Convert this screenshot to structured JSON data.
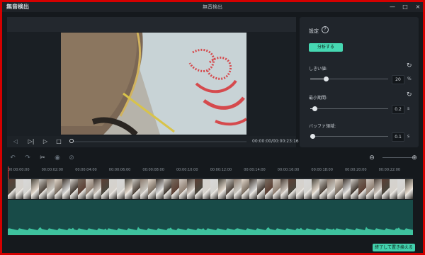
{
  "titlebar": {
    "app_title": "無音検出",
    "center_title": "無音検出",
    "controls": [
      "minimize",
      "maximize",
      "close"
    ]
  },
  "preview": {
    "timecode": "00:00:00/00:00:23:16",
    "controls": [
      "skip-back",
      "step-forward",
      "play",
      "stop"
    ]
  },
  "settings": {
    "title": "設定",
    "help_icon": "question-circle-icon",
    "analyze_button": "分析する",
    "threshold": {
      "label": "しきい値:",
      "value": "20",
      "unit": "%",
      "level": 0.2
    },
    "min_interval": {
      "label": "最小期間:",
      "value": "0.2",
      "unit": "s",
      "level": 0.05
    },
    "buffer": {
      "label": "バッファ領域:",
      "value": "0.1",
      "unit": "s",
      "level": 0.03
    }
  },
  "toolbar": {
    "icons": [
      "undo-icon",
      "redo-icon",
      "cut-icon",
      "hide-icon",
      "disable-icon"
    ],
    "zoom_icons": [
      "zoom-out-icon",
      "zoom-in-icon"
    ]
  },
  "ruler": {
    "ticks": [
      "00:00:00:00",
      "00:00:02:00",
      "00:00:04:00",
      "00:00:06:00",
      "00:00:08:00",
      "00:00:10:00",
      "00:00:12:00",
      "00:00:14:00",
      "00:00:16:00",
      "00:00:18:00",
      "00:00:20:00",
      "00:00:22:00"
    ]
  },
  "timeline": {
    "thumbnail_colors": [
      "#5b3f34",
      "#d4d3cf",
      "#d8d8d8",
      "#4a473e",
      "#c9c7c1",
      "#8d7d70",
      "#e4d9cd",
      "#3f362f",
      "#d6d2cc",
      "#766a5e",
      "#cfc7bf",
      "#4b4038"
    ],
    "audio_color": "#1b4e4a",
    "wave_color": "#3ec29e"
  },
  "footer": {
    "finish_button": "終了して置き換える"
  },
  "colors": {
    "accent": "#46d8b2",
    "window_bg": "#15191d",
    "panel_bg": "#20252b",
    "border_red": "#d40000"
  }
}
